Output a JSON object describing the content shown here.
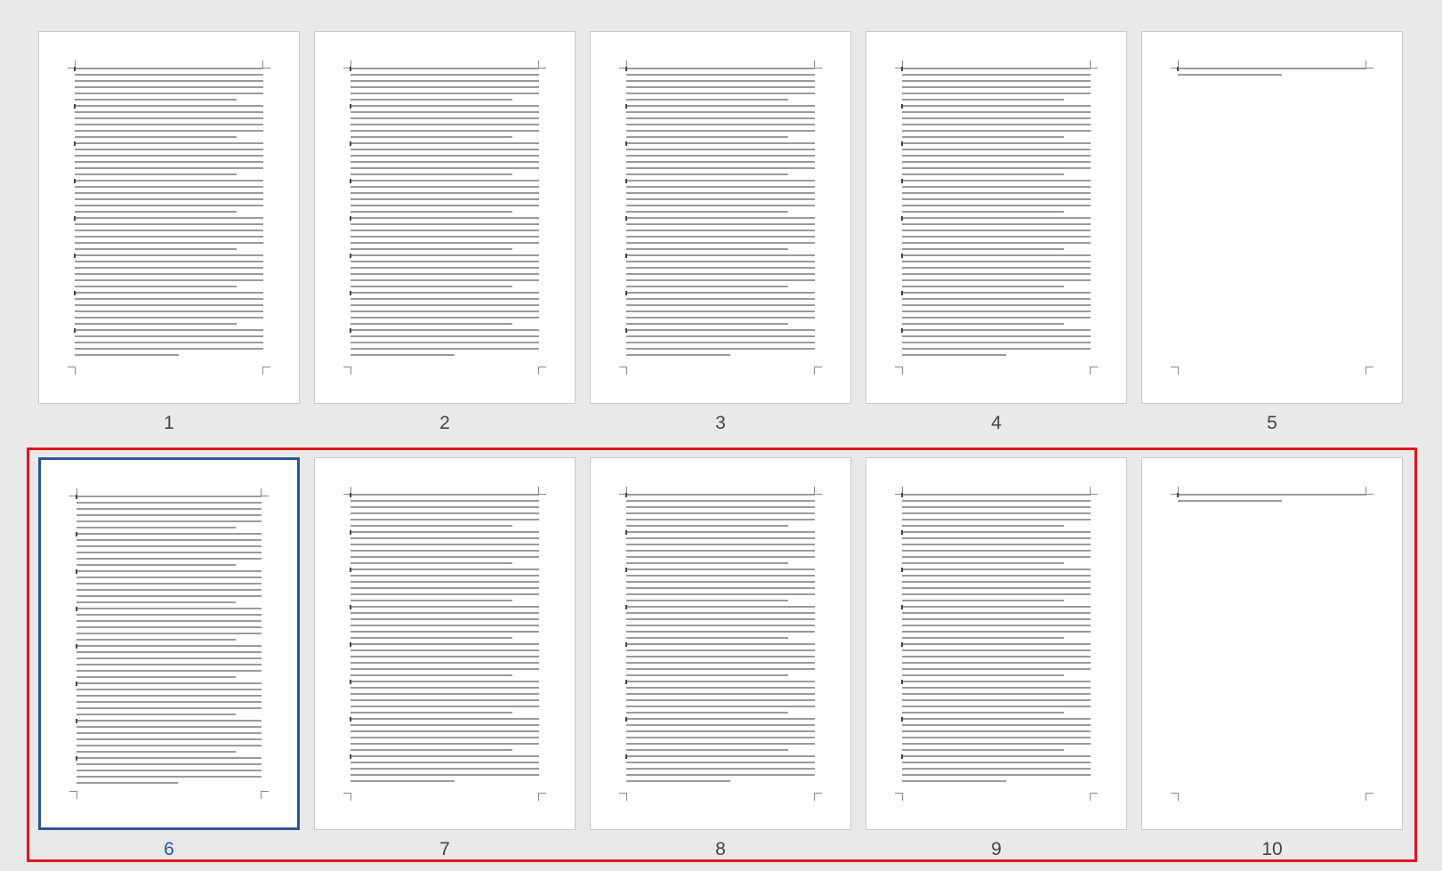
{
  "thumbnails": [
    {
      "label": "1",
      "fill": 1.0,
      "selected": false
    },
    {
      "label": "2",
      "fill": 1.0,
      "selected": false
    },
    {
      "label": "3",
      "fill": 1.0,
      "selected": false
    },
    {
      "label": "4",
      "fill": 1.0,
      "selected": false
    },
    {
      "label": "5",
      "fill": 0.05,
      "selected": false
    },
    {
      "label": "6",
      "fill": 1.0,
      "selected": true
    },
    {
      "label": "7",
      "fill": 1.0,
      "selected": false
    },
    {
      "label": "8",
      "fill": 1.0,
      "selected": false
    },
    {
      "label": "9",
      "fill": 1.0,
      "selected": false
    },
    {
      "label": "10",
      "fill": 0.05,
      "selected": false
    }
  ],
  "colors": {
    "selected_page": "#2b5797",
    "selection_range": "#e0161e",
    "background": "#e9e9e9"
  }
}
